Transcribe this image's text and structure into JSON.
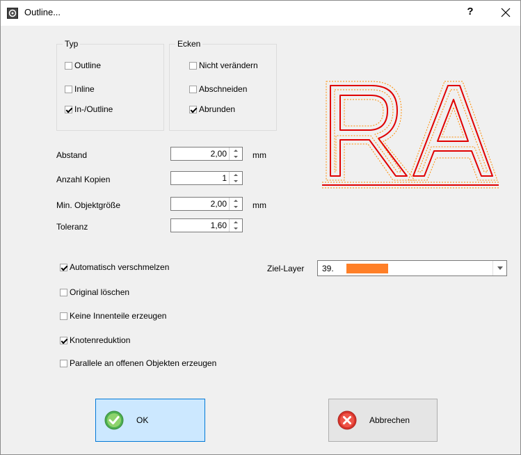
{
  "window": {
    "title": "Outline...",
    "help_label": "?"
  },
  "typ": {
    "title": "Typ",
    "options": [
      {
        "label": "Outline",
        "checked": false
      },
      {
        "label": "Inline",
        "checked": false
      },
      {
        "label": "In-/Outline",
        "checked": true
      }
    ]
  },
  "ecken": {
    "title": "Ecken",
    "options": [
      {
        "label": "Nicht verändern",
        "checked": false
      },
      {
        "label": "Abschneiden",
        "checked": false
      },
      {
        "label": "Abrunden",
        "checked": true
      }
    ]
  },
  "fields": [
    {
      "label": "Abstand",
      "value": "2,00",
      "unit": "mm"
    },
    {
      "label": "Anzahl Kopien",
      "value": "1",
      "unit": ""
    },
    {
      "label": "Min. Objektgröße",
      "value": "2,00",
      "unit": "mm"
    },
    {
      "label": "Toleranz",
      "value": "1,60",
      "unit": ""
    }
  ],
  "preview": {
    "text": "RA",
    "outline_color": "#ff0000",
    "offset_color": "#ff8c00"
  },
  "options": [
    {
      "label": "Automatisch verschmelzen",
      "checked": true
    },
    {
      "label": "Original löschen",
      "checked": false
    },
    {
      "label": "Keine Innenteile erzeugen",
      "checked": false
    },
    {
      "label": "Knotenreduktion",
      "checked": true
    },
    {
      "label": "Parallele an offenen Objekten erzeugen",
      "checked": false
    }
  ],
  "layer": {
    "label": "Ziel-Layer",
    "value": "39.",
    "color": "#ff7f27"
  },
  "buttons": {
    "ok": "OK",
    "cancel": "Abbrechen"
  }
}
